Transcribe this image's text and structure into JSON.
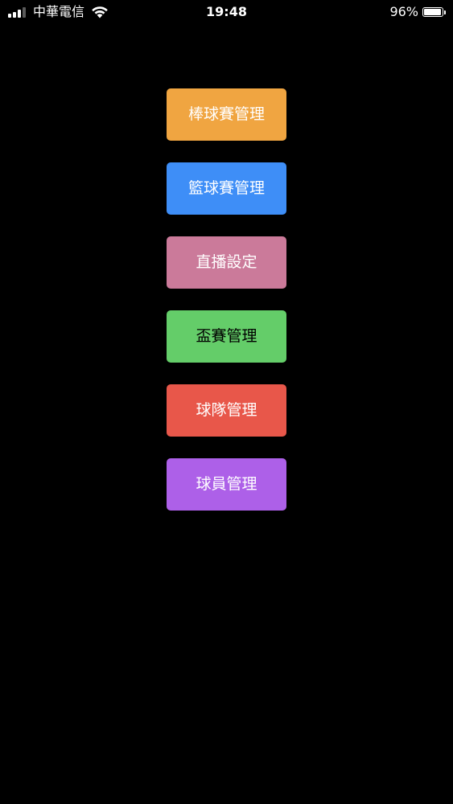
{
  "status_bar": {
    "carrier": "中華電信",
    "time": "19:48",
    "battery_percent_label": "96%",
    "battery_level": 0.96,
    "signal_bars_active": 3,
    "signal_bars_total": 4,
    "icons": [
      "signal-icon",
      "wifi-icon",
      "battery-icon"
    ]
  },
  "menu": {
    "buttons": [
      {
        "label": "棒球賽管理",
        "color": "#F0A541",
        "text_color": "#ffffff"
      },
      {
        "label": "籃球賽管理",
        "color": "#3E8EF7",
        "text_color": "#ffffff"
      },
      {
        "label": "直播設定",
        "color": "#CB7A9A",
        "text_color": "#ffffff"
      },
      {
        "label": "盃賽管理",
        "color": "#64CD69",
        "text_color": "#000000"
      },
      {
        "label": "球隊管理",
        "color": "#E8574A",
        "text_color": "#ffffff"
      },
      {
        "label": "球員管理",
        "color": "#AD60E8",
        "text_color": "#ffffff"
      }
    ]
  },
  "theme": {
    "background": "#000000"
  }
}
